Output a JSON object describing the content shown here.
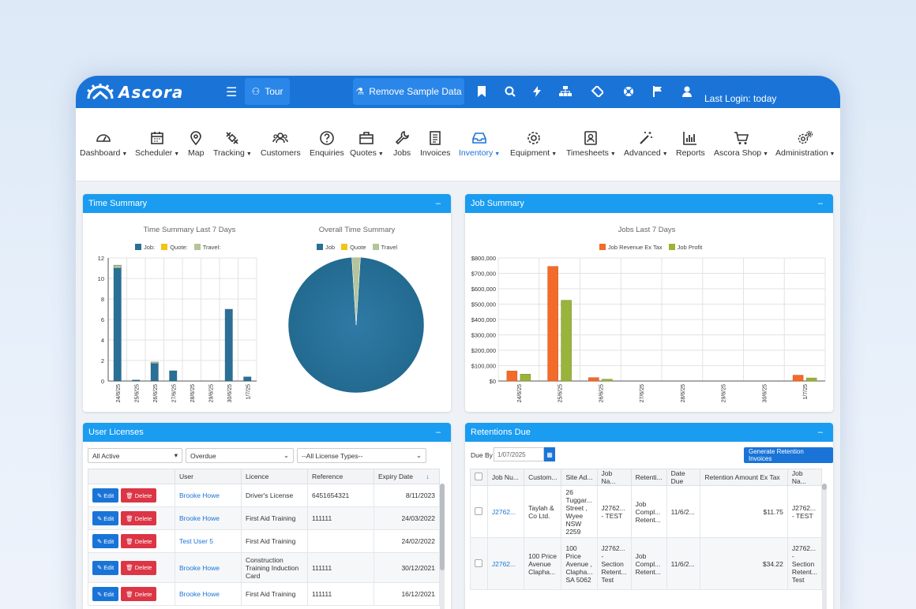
{
  "app": {
    "brand": "Ascora",
    "tour_label": "Tour",
    "remove_sample_label": "Remove Sample Data",
    "last_login": "Last Login: today"
  },
  "nav": [
    {
      "label": "Dashboard",
      "caret": true,
      "icon": "dashboard-icon"
    },
    {
      "label": "Scheduler",
      "caret": true,
      "icon": "calendar-icon"
    },
    {
      "label": "Map",
      "caret": false,
      "icon": "map-pin-icon"
    },
    {
      "label": "Tracking",
      "caret": true,
      "icon": "satellite-icon"
    },
    {
      "label": "Customers",
      "caret": false,
      "icon": "users-icon"
    },
    {
      "label": "Enquiries",
      "caret": false,
      "icon": "question-icon"
    },
    {
      "label": "Quotes",
      "caret": true,
      "icon": "briefcase-icon"
    },
    {
      "label": "Jobs",
      "caret": false,
      "icon": "wrench-icon"
    },
    {
      "label": "Invoices",
      "caret": false,
      "icon": "invoice-icon"
    },
    {
      "label": "Inventory",
      "caret": true,
      "icon": "inbox-icon",
      "active": true
    },
    {
      "label": "Equipment",
      "caret": true,
      "icon": "gear-icon"
    },
    {
      "label": "Timesheets",
      "caret": true,
      "icon": "timesheet-icon"
    },
    {
      "label": "Advanced",
      "caret": true,
      "icon": "magic-wand-icon"
    },
    {
      "label": "Reports",
      "caret": false,
      "icon": "bar-chart-icon"
    },
    {
      "label": "Ascora Shop",
      "caret": true,
      "icon": "cart-icon"
    },
    {
      "label": "Administration",
      "caret": true,
      "icon": "gears-icon"
    }
  ],
  "panels": {
    "time_summary": "Time Summary",
    "job_summary": "Job Summary",
    "user_licenses": "User Licenses",
    "retentions_due": "Retentions Due",
    "minimize": "–"
  },
  "chart_data": [
    {
      "type": "bar",
      "title": "Time Summary Last 7 Days",
      "categories": [
        "24/6/25",
        "25/6/25",
        "26/6/25",
        "27/6/25",
        "28/6/25",
        "29/6/25",
        "30/6/25",
        "1/7/25"
      ],
      "series": [
        {
          "name": "Job:",
          "values": [
            11,
            0.1,
            1.7,
            1,
            0,
            0,
            7,
            0.4
          ],
          "color": "#2a6f95"
        },
        {
          "name": "Quote:",
          "values": [
            0,
            0,
            0,
            0,
            0,
            0,
            0,
            0
          ],
          "color": "#f0c419"
        },
        {
          "name": "Travel:",
          "values": [
            0.3,
            0,
            0.15,
            0,
            0,
            0,
            0,
            0
          ],
          "color": "#b5c49a"
        }
      ],
      "stacked": true,
      "ylim": [
        0,
        12
      ],
      "yticks": [
        0,
        2,
        4,
        6,
        8,
        10,
        12
      ],
      "grid": true,
      "legend": "top"
    },
    {
      "type": "pie",
      "title": "Overall Time Summary",
      "labels": [
        "Job",
        "Quote",
        "Travel"
      ],
      "values": [
        98,
        0,
        2
      ],
      "colors": [
        "#2a6f95",
        "#f0c419",
        "#b5c49a"
      ],
      "legend": "top"
    },
    {
      "type": "bar",
      "title": "Jobs Last 7 Days",
      "categories": [
        "24/6/25",
        "25/6/25",
        "26/6/25",
        "27/6/25",
        "28/6/25",
        "29/6/25",
        "30/6/25",
        "1/7/25"
      ],
      "series": [
        {
          "name": "Job Revenue Ex Tax",
          "values": [
            65000,
            745000,
            22000,
            0,
            0,
            0,
            0,
            38000
          ],
          "color": "#f26b2a"
        },
        {
          "name": "Job Profit",
          "values": [
            45000,
            525000,
            12000,
            0,
            0,
            0,
            0,
            20000
          ],
          "color": "#99b33b"
        }
      ],
      "ylim": [
        0,
        800000
      ],
      "yticks": [
        "$0",
        "$100,000",
        "$200,000",
        "$300,000",
        "$400,000",
        "$500,000",
        "$600,000",
        "$700,000",
        "$800,000"
      ],
      "grid": true,
      "legend": "top"
    }
  ],
  "licenses": {
    "filters": [
      "All Active",
      "Overdue",
      "--All License Types--"
    ],
    "columns": [
      "",
      "User",
      "Licence",
      "Reference",
      "Expiry Date"
    ],
    "sort_icon": "↓",
    "edit_label": "Edit",
    "delete_label": "Delete",
    "rows": [
      {
        "user": "Brooke Howe",
        "licence": "Driver's License",
        "reference": "6451654321",
        "expiry": "8/11/2023"
      },
      {
        "user": "Brooke Howe",
        "licence": "First Aid Training",
        "reference": "111111",
        "expiry": "24/03/2022"
      },
      {
        "user": "Test User 5",
        "licence": "First Aid Training",
        "reference": "",
        "expiry": "24/02/2022"
      },
      {
        "user": "Brooke Howe",
        "licence": "Construction Training Induction Card",
        "reference": "111111",
        "expiry": "30/12/2021"
      },
      {
        "user": "Brooke Howe",
        "licence": "First Aid Training",
        "reference": "111111",
        "expiry": "16/12/2021"
      }
    ]
  },
  "retentions": {
    "due_by_label": "Due By",
    "due_by_value": "1/07/2025",
    "generate_label": "Generate Retention Invoices",
    "columns": [
      "",
      "Job Nu...",
      "Custom...",
      "Site Ad...",
      "Job Na...",
      "Retenti...",
      "Date Due",
      "Retention Amount Ex Tax",
      "Job Na..."
    ],
    "rows": [
      {
        "job": "J2762...",
        "customer": "Taylah & Co Ltd.",
        "site": "26 Tuggar... Street , Wyee NSW 2259",
        "jobname": "J2762... - TEST",
        "retention": "Job Compl... Retent...",
        "date": "11/6/2...",
        "amount": "$11.75",
        "jobname2": "J2762... - TEST"
      },
      {
        "job": "J2762...",
        "customer": "100 Price Avenue Clapha...",
        "site": "100 Price Avenue , Clapha... SA 5062",
        "jobname": "J2762... - Section Retent... Test",
        "retention": "Job Compl... Retent...",
        "date": "11/6/2...",
        "amount": "$34.22",
        "jobname2": "J2762... - Section Retent... Test"
      }
    ]
  }
}
